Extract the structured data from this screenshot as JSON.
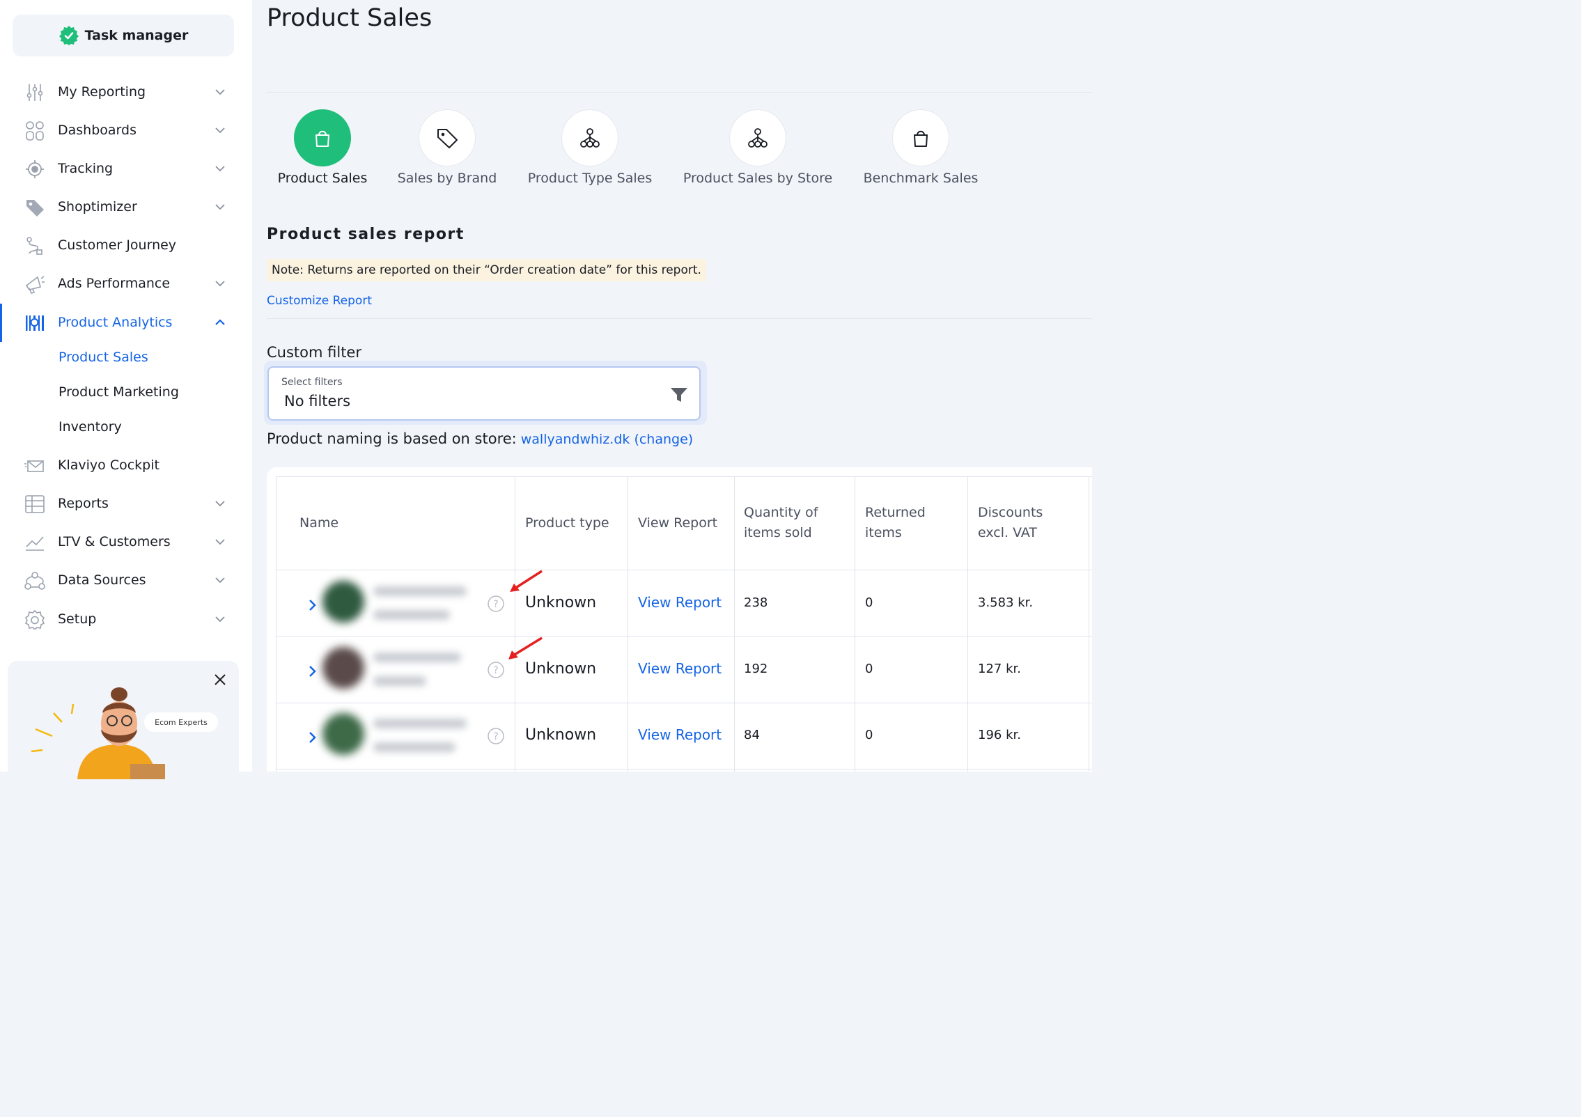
{
  "brand": {
    "name": "Task manager"
  },
  "sidebar": {
    "items": [
      {
        "label": "My Reporting",
        "icon": "sliders-icon",
        "chevron": "down"
      },
      {
        "label": "Dashboards",
        "icon": "grid-icon",
        "chevron": "down"
      },
      {
        "label": "Tracking",
        "icon": "crosshair-icon",
        "chevron": "down"
      },
      {
        "label": "Shoptimizer",
        "icon": "tag-icon",
        "chevron": "down"
      },
      {
        "label": "Customer Journey",
        "icon": "route-icon",
        "chevron": ""
      },
      {
        "label": "Ads Performance",
        "icon": "megaphone-icon",
        "chevron": "down"
      },
      {
        "label": "Product Analytics",
        "icon": "barcode-icon",
        "chevron": "up",
        "active": true
      },
      {
        "label": "Klaviyo Cockpit",
        "icon": "mail-icon",
        "chevron": ""
      },
      {
        "label": "Reports",
        "icon": "table-icon",
        "chevron": "down"
      },
      {
        "label": "LTV & Customers",
        "icon": "trend-icon",
        "chevron": "down"
      },
      {
        "label": "Data Sources",
        "icon": "nodes-icon",
        "chevron": "down"
      },
      {
        "label": "Setup",
        "icon": "gear-icon",
        "chevron": "down"
      }
    ],
    "sub_items": [
      {
        "label": "Product Sales",
        "active": true
      },
      {
        "label": "Product Marketing"
      },
      {
        "label": "Inventory"
      }
    ],
    "promo": {
      "pill": "Ecom Experts"
    }
  },
  "page": {
    "title": "Product Sales"
  },
  "tabs": [
    {
      "label": "Product Sales",
      "icon": "bag-icon",
      "active": true
    },
    {
      "label": "Sales by Brand",
      "icon": "tag-icon"
    },
    {
      "label": "Product Type Sales",
      "icon": "hierarchy-icon"
    },
    {
      "label": "Product Sales by Store",
      "icon": "hierarchy-icon"
    },
    {
      "label": "Benchmark Sales",
      "icon": "bag-icon"
    }
  ],
  "report": {
    "title": "Product sales report",
    "note": "Note: Returns are reported on their “Order creation date” for this report.",
    "customize": "Customize Report"
  },
  "filter": {
    "label": "Custom filter",
    "small": "Select filters",
    "value": "No filters"
  },
  "naming": {
    "text": "Product naming is based on store:",
    "store": "wallyandwhiz.dk (change)"
  },
  "table": {
    "columns": [
      "Name",
      "Product type",
      "View Report",
      "Quantity of items sold",
      "Returned items",
      "Discounts excl. VAT"
    ],
    "col_lines": [
      [
        "Name"
      ],
      [
        "Product type"
      ],
      [
        "View Report"
      ],
      [
        "Quantity of",
        "items sold"
      ],
      [
        "Returned",
        "items"
      ],
      [
        "Discounts",
        "excl. VAT"
      ]
    ],
    "rows": [
      {
        "type": "Unknown",
        "view": "View Report",
        "qty": "238",
        "returned": "0",
        "discount": "3.583 kr."
      },
      {
        "type": "Unknown",
        "view": "View Report",
        "qty": "192",
        "returned": "0",
        "discount": "127 kr."
      },
      {
        "type": "Unknown",
        "view": "View Report",
        "qty": "84",
        "returned": "0",
        "discount": "196 kr."
      }
    ]
  },
  "colors": {
    "accent": "#1464e6",
    "active_tab": "#1fbe7a",
    "arrow": "#e52020"
  }
}
